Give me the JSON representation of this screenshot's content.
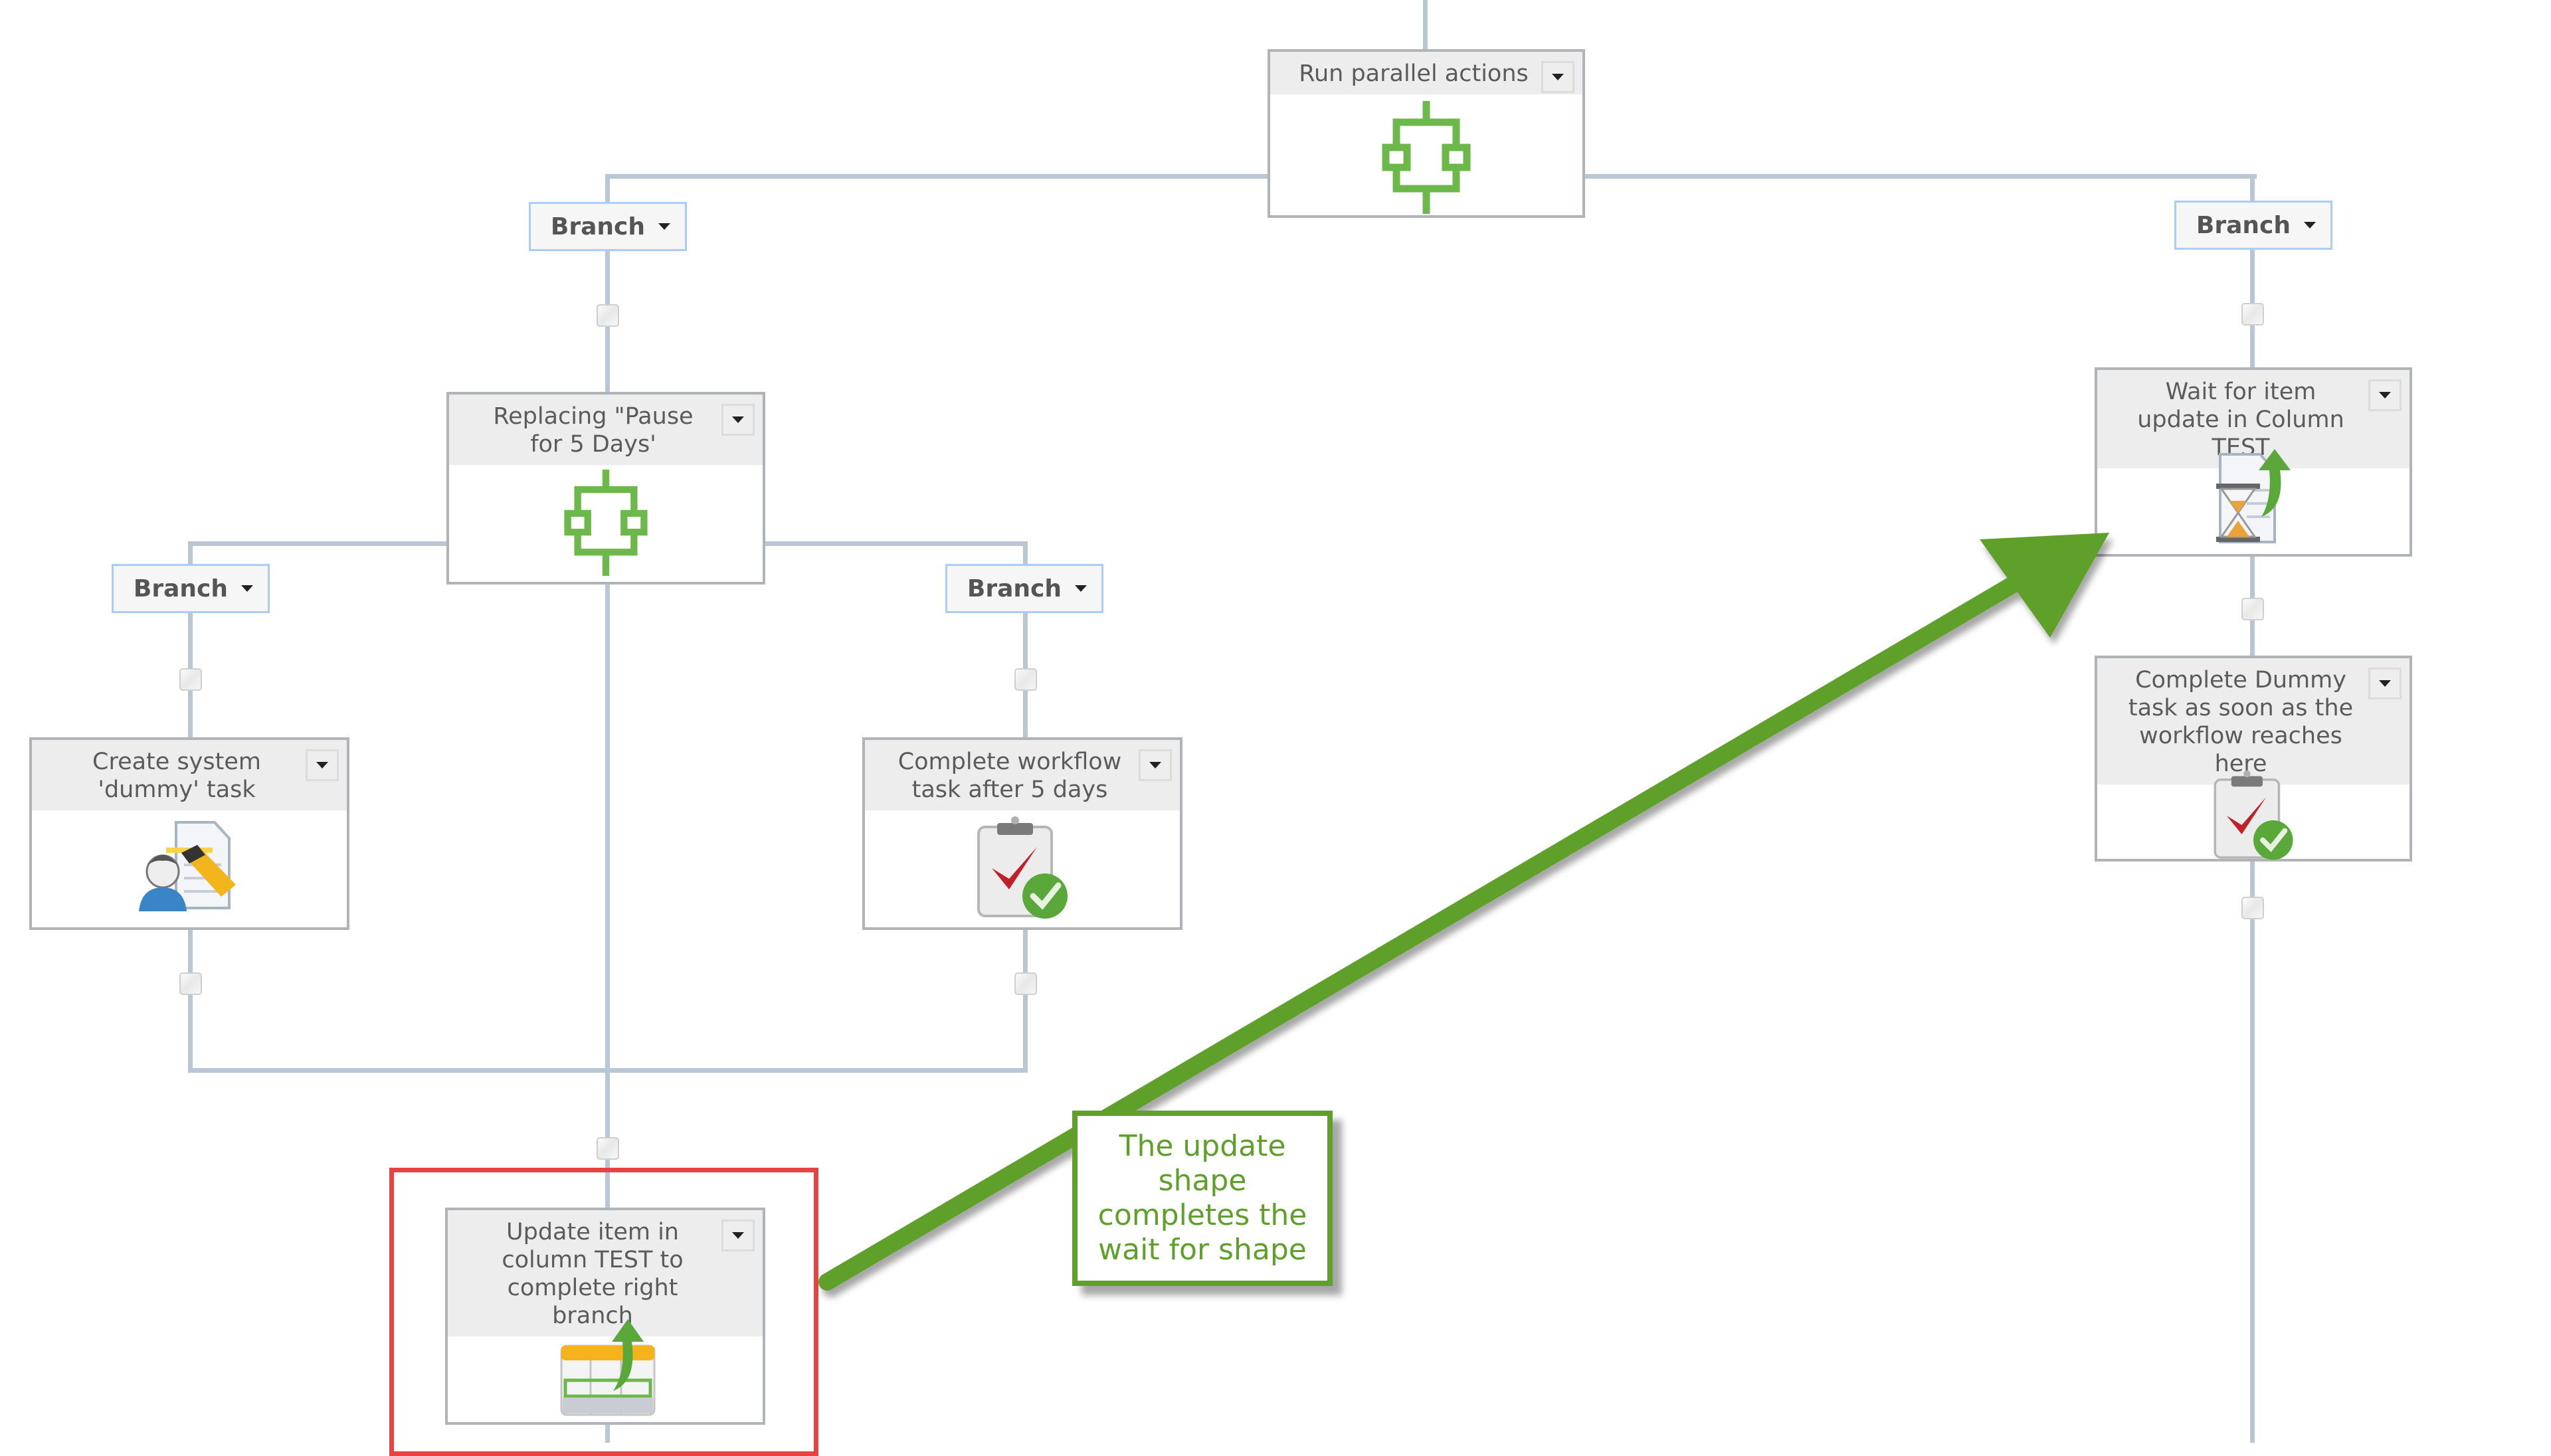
{
  "diagram": {
    "root_action": {
      "title": "Run parallel actions",
      "icon": "parallel-actions-icon"
    },
    "branch_label": "Branch",
    "left_branch": {
      "action": {
        "title": "Replacing \"Pause for 5 Days'",
        "icon": "parallel-actions-icon"
      },
      "sub_branches": [
        {
          "label": "Branch",
          "action": {
            "title": "Create system 'dummy' task",
            "icon": "user-task-icon"
          }
        },
        {
          "label": "Branch",
          "action": {
            "title": "Complete workflow task after 5 days",
            "icon": "clipboard-check-icon"
          }
        }
      ],
      "after_merge": {
        "title": "Update item in column TEST to complete right branch",
        "icon": "update-item-icon"
      }
    },
    "right_branch": {
      "label": "Branch",
      "actions": [
        {
          "title": "Wait for item update in Column TEST",
          "icon": "wait-for-update-icon"
        },
        {
          "title": "Complete Dummy task as soon as the workflow reaches here",
          "icon": "clipboard-check-icon"
        }
      ]
    },
    "annotation": {
      "text": "The update shape completes the wait for shape",
      "color": "#5fa02a",
      "highlight_color": "#e84343"
    }
  },
  "colors": {
    "connector_line": "#b9c6d4",
    "branch_border": "#a9cdf7",
    "header_bg": "#ededed",
    "icon_green": "#6db84a"
  }
}
